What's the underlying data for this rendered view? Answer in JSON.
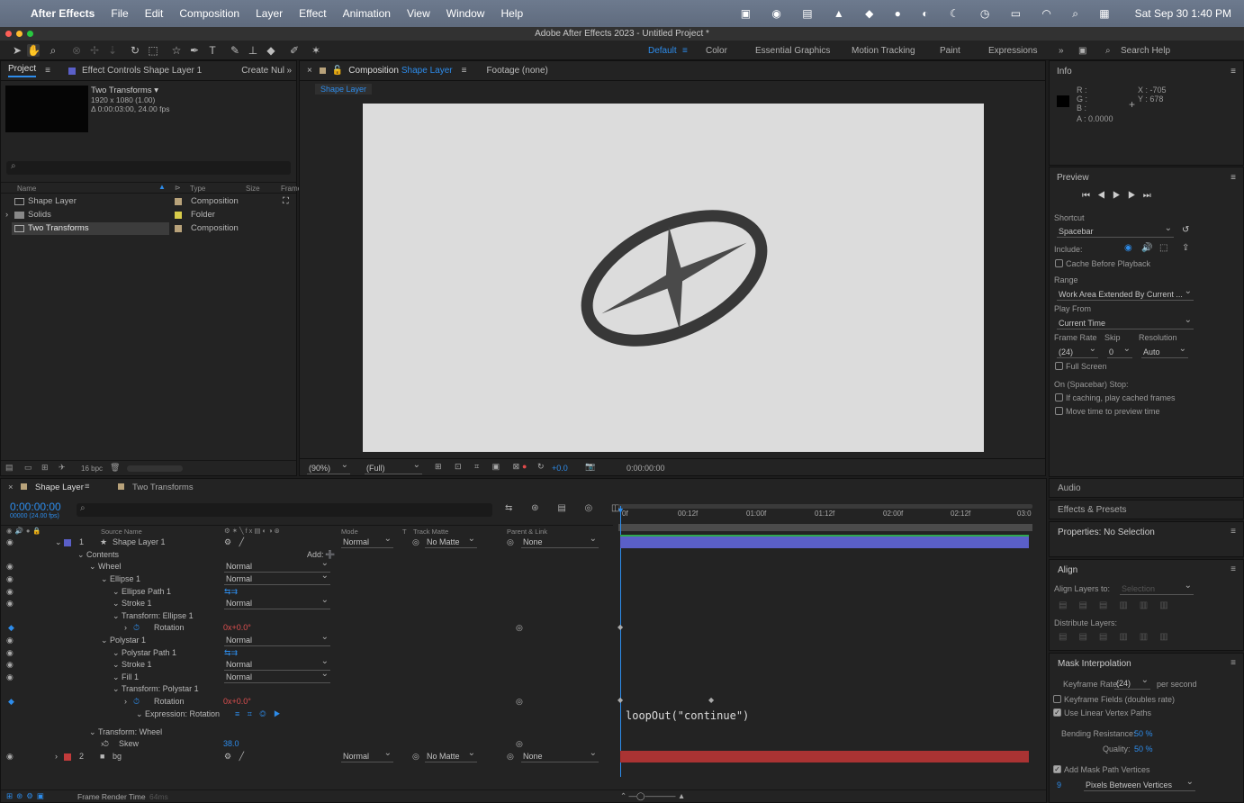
{
  "menubar": {
    "app": "After Effects",
    "items": [
      "File",
      "Edit",
      "Composition",
      "Layer",
      "Effect",
      "Animation",
      "View",
      "Window",
      "Help"
    ],
    "clock": "Sat Sep 30  1:40 PM"
  },
  "window": {
    "title": "Adobe After Effects 2023 - Untitled Project *"
  },
  "workspaces": {
    "default": "Default",
    "items": [
      "Color",
      "Essential Graphics",
      "Motion Tracking",
      "Paint",
      "Expressions"
    ],
    "search_placeholder": "Search Help"
  },
  "project": {
    "tab": "Project",
    "tab2": "Effect Controls Shape Layer 1",
    "tab3": "Create Nul",
    "comp_name": "Two Transforms ▾",
    "comp_size": "1920 x 1080 (1.00)",
    "comp_dur": "Δ 0:00:03:00, 24.00 fps",
    "cols": {
      "name": "Name",
      "type": "Type",
      "size": "Size",
      "frame": "Frame"
    },
    "items": [
      {
        "name": "Shape Layer",
        "type": "Composition",
        "color": "#b8a27a"
      },
      {
        "name": "Solids",
        "type": "Folder",
        "color": "#d8cc4a"
      },
      {
        "name": "Two Transforms",
        "type": "Composition",
        "color": "#b8a27a"
      }
    ],
    "bpc": "16 bpc"
  },
  "comp": {
    "tab_prefix": "Composition",
    "tab_name": "Shape Layer",
    "footage": "Footage (none)",
    "crumb": "Shape Layer",
    "zoom": "(90%)",
    "res": "(Full)",
    "exposure": "+0.0",
    "time": "0:00:00:00"
  },
  "info": {
    "title": "Info",
    "r": "R :",
    "g": "G :",
    "b": "B :",
    "a": "A : 0.0000",
    "x": "X : -705",
    "y": "Y : 678"
  },
  "preview": {
    "title": "Preview",
    "shortcut_label": "Shortcut",
    "shortcut": "Spacebar",
    "include": "Include:",
    "cache": "Cache Before Playback",
    "range_label": "Range",
    "range": "Work Area Extended By Current ...",
    "playfrom_label": "Play From",
    "playfrom": "Current Time",
    "framerate_label": "Frame Rate",
    "skip_label": "Skip",
    "resolution_label": "Resolution",
    "framerate": "(24)",
    "skip": "0",
    "resolution": "Auto",
    "fullscreen": "Full Screen",
    "stop_label": "On (Spacebar) Stop:",
    "stop1": "If caching, play cached frames",
    "stop2": "Move time to preview time"
  },
  "side": {
    "audio": "Audio",
    "effects": "Effects & Presets",
    "properties": "Properties: No Selection",
    "align": "Align",
    "align_to_label": "Align Layers to:",
    "align_to": "Selection",
    "distribute": "Distribute Layers:",
    "mask": "Mask Interpolation",
    "kf_rate_label": "Keyframe Rate:",
    "kf_rate": "(24)",
    "per_second": "per second",
    "kf_fields": "Keyframe Fields (doubles rate)",
    "linear": "Use Linear Vertex Paths",
    "bending_label": "Bending Resistance:",
    "bending": "50 %",
    "quality_label": "Quality:",
    "quality": "50 %",
    "add_vertices": "Add Mask Path Vertices",
    "vertices_val": "9",
    "vertices_mode": "Pixels Between Vertices"
  },
  "timeline": {
    "tab1": "Shape Layer",
    "tab2": "Two Transforms",
    "timecode": "0:00:00:00",
    "timecode_sub": "00000 (24.00 fps)",
    "cols": {
      "source": "Source Name",
      "mode": "Mode",
      "t": "T",
      "matte": "Track Matte",
      "parent": "Parent & Link"
    },
    "ruler": [
      "0f",
      "00:12f",
      "01:00f",
      "01:12f",
      "02:00f",
      "02:12f",
      "03:0"
    ],
    "add_label": "Add:",
    "expression": "loopOut(\"continue\")",
    "footer": "Frame Render Time",
    "footer_val": "64ms",
    "rows": [
      {
        "indent": 0,
        "num": "1",
        "label": "Shape Layer 1",
        "mode": "Normal",
        "matte": "No Matte",
        "parent": "None"
      },
      {
        "indent": 1,
        "label": "Contents"
      },
      {
        "indent": 2,
        "label": "Wheel",
        "mode": "Normal"
      },
      {
        "indent": 3,
        "label": "Ellipse 1",
        "mode": "Normal"
      },
      {
        "indent": 4,
        "label": "Ellipse Path 1"
      },
      {
        "indent": 4,
        "label": "Stroke 1",
        "mode": "Normal"
      },
      {
        "indent": 4,
        "label": "Transform: Ellipse 1"
      },
      {
        "indent": 5,
        "label": "Rotation",
        "value": "0x+0.0°"
      },
      {
        "indent": 3,
        "label": "Polystar 1",
        "mode": "Normal"
      },
      {
        "indent": 4,
        "label": "Polystar Path 1"
      },
      {
        "indent": 4,
        "label": "Stroke 1",
        "mode": "Normal"
      },
      {
        "indent": 4,
        "label": "Fill 1",
        "mode": "Normal"
      },
      {
        "indent": 4,
        "label": "Transform: Polystar 1"
      },
      {
        "indent": 5,
        "label": "Rotation",
        "value": "0x+0.0°"
      },
      {
        "indent": 6,
        "label": "Expression: Rotation"
      },
      {
        "indent": 2,
        "label": "Transform: Wheel"
      },
      {
        "indent": 3,
        "label": "Skew",
        "value": "38.0"
      },
      {
        "indent": 0,
        "num": "2",
        "label": "bg",
        "mode": "Normal",
        "matte": "No Matte",
        "parent": "None"
      }
    ]
  },
  "colors": {
    "accent": "#2d8ceb",
    "layer1": "#5a5fc8",
    "layer2": "#c23b3b",
    "canvas": "#dcdcdc",
    "shape": "#383838",
    "keyred": "#e05050"
  }
}
